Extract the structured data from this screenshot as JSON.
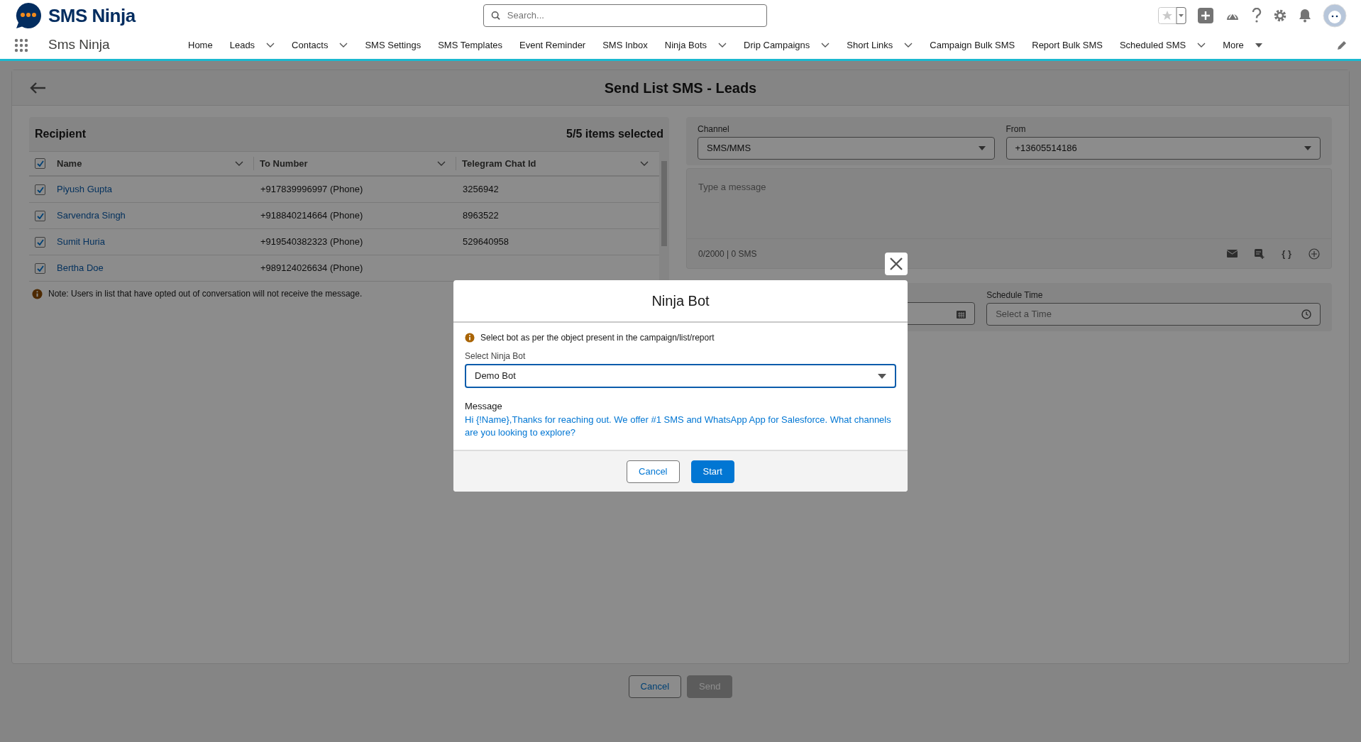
{
  "header": {
    "logo_text": "SMS Ninja",
    "search": {
      "placeholder": "Search..."
    },
    "app_name": "Sms Ninja"
  },
  "nav": [
    {
      "label": "Home",
      "kind": "plain"
    },
    {
      "label": "Leads",
      "kind": "dropdown"
    },
    {
      "label": "Contacts",
      "kind": "dropdown"
    },
    {
      "label": "SMS Settings",
      "kind": "plain"
    },
    {
      "label": "SMS Templates",
      "kind": "plain"
    },
    {
      "label": "Event Reminder",
      "kind": "plain"
    },
    {
      "label": "SMS Inbox",
      "kind": "plain"
    },
    {
      "label": "Ninja Bots",
      "kind": "dropdown"
    },
    {
      "label": "Drip Campaigns",
      "kind": "dropdown"
    },
    {
      "label": "Short Links",
      "kind": "dropdown"
    },
    {
      "label": "Campaign Bulk SMS",
      "kind": "plain"
    },
    {
      "label": "Report Bulk SMS",
      "kind": "plain"
    },
    {
      "label": "Scheduled SMS",
      "kind": "dropdown"
    },
    {
      "label": "More",
      "kind": "overflow"
    }
  ],
  "page": {
    "title": "Send List SMS - Leads"
  },
  "recipients": {
    "title": "Recipient",
    "selection": "5/5 items selected",
    "all_checked": true,
    "columns": [
      "Name",
      "To Number",
      "Telegram Chat Id"
    ],
    "rows": [
      {
        "name": "Piyush Gupta",
        "to_number": "+917839996997 (Phone)",
        "telegram_chat_id": "3256942",
        "checked": true
      },
      {
        "name": "Sarvendra Singh",
        "to_number": "+918840214664 (Phone)",
        "telegram_chat_id": "8963522",
        "checked": true
      },
      {
        "name": "Sumit Huria",
        "to_number": "+919540382323 (Phone)",
        "telegram_chat_id": "529640958",
        "checked": true
      },
      {
        "name": "Bertha Doe",
        "to_number": "+989124026634 (Phone)",
        "checked": true
      }
    ],
    "note": "Note: Users in list that have opted out of conversation will not receive the message."
  },
  "composer": {
    "channel": {
      "label": "Channel",
      "value": "SMS/MMS"
    },
    "from": {
      "label": "From",
      "value": "+13605514186"
    },
    "message": {
      "placeholder": "Type a message"
    },
    "counter": "0/2000 | 0 SMS",
    "merge_field_button": "{ }",
    "schedule_time": {
      "label": "Schedule Time",
      "placeholder": "Select a Time"
    }
  },
  "footer_buttons": [
    {
      "label": "Cancel",
      "kind": "secondary",
      "disabled": false
    },
    {
      "label": "Send",
      "kind": "primary",
      "disabled": true
    }
  ],
  "modal": {
    "title": "Ninja Bot",
    "info": "Select bot as per the object present in the campaign/list/report",
    "select": {
      "label": "Select Ninja Bot",
      "value": "Demo Bot"
    },
    "message_label": "Message",
    "message": "Hi {!Name},Thanks for reaching out. We offer #1 SMS and WhatsApp App for Salesforce. What channels are you looking to explore?",
    "buttons": [
      {
        "label": "Cancel",
        "kind": "secondary"
      },
      {
        "label": "Start",
        "kind": "primary"
      }
    ]
  }
}
